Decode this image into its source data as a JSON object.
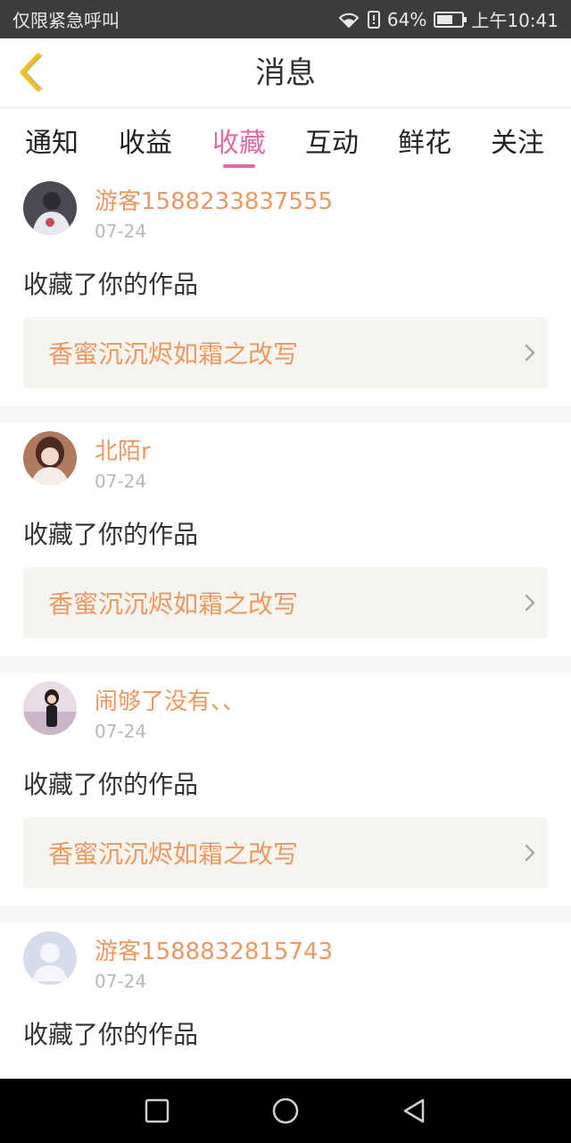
{
  "status_bar": {
    "carrier": "仅限紧急呼叫",
    "battery": "64%",
    "time": "上午10:41",
    "battery_level": 0.64
  },
  "header": {
    "title": "消息",
    "back_icon": "chevron-left-icon"
  },
  "tabs": [
    {
      "label": "通知",
      "active": false
    },
    {
      "label": "收益",
      "active": false
    },
    {
      "label": "收藏",
      "active": true
    },
    {
      "label": "互动",
      "active": false
    },
    {
      "label": "鲜花",
      "active": false
    },
    {
      "label": "关注",
      "active": false
    }
  ],
  "messages": [
    {
      "username": "游客1588233837555",
      "date": "07-24",
      "action": "收藏了你的作品",
      "work_title": "香蜜沉沉烬如霜之改写"
    },
    {
      "username": "北陌r",
      "date": "07-24",
      "action": "收藏了你的作品",
      "work_title": "香蜜沉沉烬如霜之改写"
    },
    {
      "username": "闹够了没有、、",
      "date": "07-24",
      "action": "收藏了你的作品",
      "work_title": "香蜜沉沉烬如霜之改写"
    },
    {
      "username": "游客1588832815743",
      "date": "07-24",
      "action": "收藏了你的作品",
      "work_title": ""
    }
  ],
  "colors": {
    "accent": "#e26ba3",
    "username": "#ef9761",
    "back_icon": "#f0c020",
    "link_bg": "#f5f4ee"
  }
}
